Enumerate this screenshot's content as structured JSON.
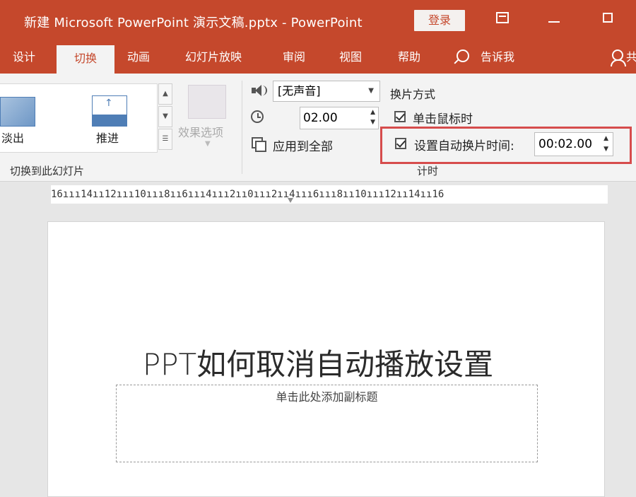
{
  "window": {
    "title": "新建 Microsoft PowerPoint 演示文稿.pptx  -  PowerPoint",
    "login_label": "登录"
  },
  "tabs": [
    {
      "label": "设计"
    },
    {
      "label": "切换"
    },
    {
      "label": "动画"
    },
    {
      "label": "幻灯片放映"
    },
    {
      "label": "审阅"
    },
    {
      "label": "视图"
    },
    {
      "label": "帮助"
    },
    {
      "label": "告诉我"
    },
    {
      "label": "共"
    }
  ],
  "ribbon": {
    "transitions": {
      "items": [
        {
          "label": "淡出"
        },
        {
          "label": "推进"
        }
      ],
      "effect_options": "效果选项",
      "group_label": "切换到此幻灯片"
    },
    "timing": {
      "sound": "[无声音]",
      "duration": "02.00",
      "apply_all": "应用到全部",
      "advance_title": "换片方式",
      "on_click": "单击鼠标时",
      "after_time_label": "设置自动换片时间:",
      "after_time_value": "00:02.00",
      "group_label": "计时"
    }
  },
  "ruler": {
    "text": "16ııı14ıı12ııı10ııı8ıı6ııı4ııı2ıı0ııı2ıı4ııı6ııı8ıı10ııı12ıı14ıı16"
  },
  "slide": {
    "title": "PPT如何取消自动播放设置",
    "subtitle_placeholder": "单击此处添加副标题"
  },
  "colors": {
    "accent": "#c5482c",
    "highlight": "#d64c4c"
  }
}
